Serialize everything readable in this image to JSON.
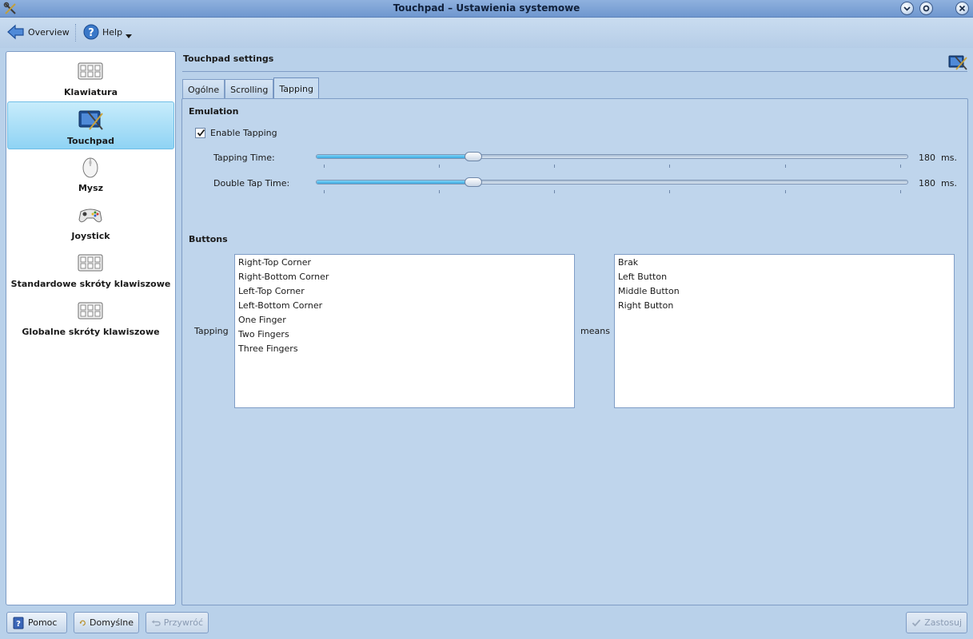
{
  "window": {
    "title": "Touchpad – Ustawienia systemowe"
  },
  "toolbar": {
    "overview_label": "Overview",
    "help_label": "Help"
  },
  "sidebar": {
    "items": [
      {
        "label": "Klawiatura",
        "icon": "keyboard-icon",
        "selected": false
      },
      {
        "label": "Touchpad",
        "icon": "touchpad-icon",
        "selected": true
      },
      {
        "label": "Mysz",
        "icon": "mouse-icon",
        "selected": false
      },
      {
        "label": "Joystick",
        "icon": "joystick-icon",
        "selected": false
      },
      {
        "label": "Standardowe skróty klawiszowe",
        "icon": "keyboard-icon",
        "selected": false
      },
      {
        "label": "Globalne skróty klawiszowe",
        "icon": "keyboard-icon",
        "selected": false
      }
    ]
  },
  "header": {
    "title": "Touchpad settings"
  },
  "tabs": [
    {
      "label": "Ogólne",
      "active": false
    },
    {
      "label": "Scrolling",
      "active": false
    },
    {
      "label": "Tapping",
      "active": true
    }
  ],
  "emulation": {
    "group_title": "Emulation",
    "enable_tapping_label": "Enable Tapping",
    "enable_tapping_checked": true,
    "tapping_time": {
      "label": "Tapping Time:",
      "value": "180",
      "unit": "ms.",
      "fraction": 0.265
    },
    "double_tap_time": {
      "label": "Double Tap Time:",
      "value": "180",
      "unit": "ms.",
      "fraction": 0.265
    }
  },
  "buttons_group": {
    "group_title": "Buttons",
    "tapping_label": "Tapping",
    "means_label": "means",
    "tapping_list": [
      "Right-Top Corner",
      "Right-Bottom Corner",
      "Left-Top Corner",
      "Left-Bottom Corner",
      "One Finger",
      "Two Fingers",
      "Three Fingers"
    ],
    "means_list": [
      "Brak",
      "Left Button",
      "Middle Button",
      "Right Button"
    ]
  },
  "footer": {
    "help_label": "Pomoc",
    "defaults_label": "Domyślne",
    "reset_label": "Przywróć",
    "apply_label": "Zastosuj"
  },
  "colors": {
    "selection": "#8fd3f4",
    "window_bg": "#b9d1ea",
    "slider_fill": "#3aa8e0"
  }
}
